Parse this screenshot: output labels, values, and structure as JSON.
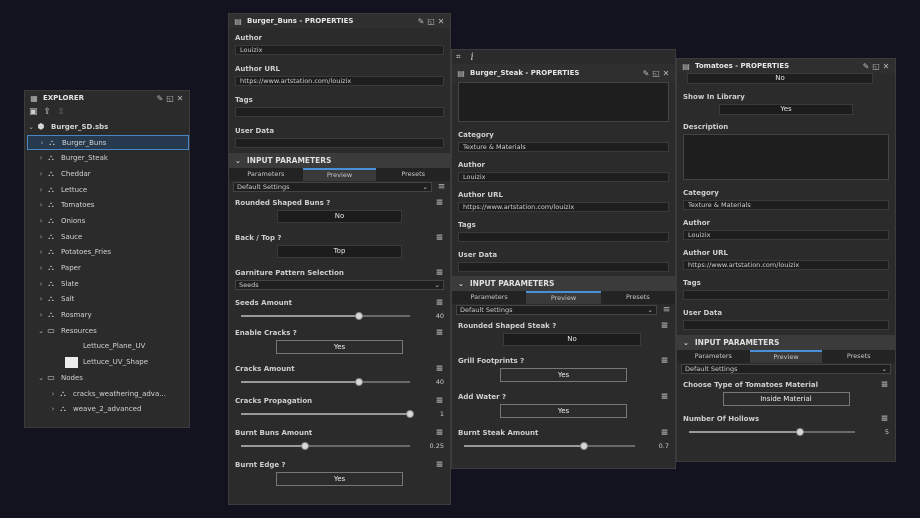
{
  "explorer": {
    "title": "EXPLORER",
    "package": "Burger_SD.sbs",
    "items": [
      {
        "label": "Burger_Buns"
      },
      {
        "label": "Burger_Steak"
      },
      {
        "label": "Cheddar"
      },
      {
        "label": "Lettuce"
      },
      {
        "label": "Tomatoes"
      },
      {
        "label": "Onions"
      },
      {
        "label": "Sauce"
      },
      {
        "label": "Potatoes_Fries"
      },
      {
        "label": "Paper"
      },
      {
        "label": "Slate"
      },
      {
        "label": "Salt"
      },
      {
        "label": "Rosmary"
      }
    ],
    "resources": {
      "label": "Resources",
      "children": [
        {
          "label": "Lettuce_Plane_UV"
        },
        {
          "label": "Lettuce_UV_Shape"
        }
      ]
    },
    "nodes": {
      "label": "Nodes",
      "children": [
        {
          "label": "cracks_weathering_adva..."
        },
        {
          "label": "weave_2_advanced"
        }
      ]
    }
  },
  "common": {
    "author_label": "Author",
    "author_url_label": "Author URL",
    "tags_label": "Tags",
    "user_data_label": "User Data",
    "category_label": "Category",
    "description_label": "Description",
    "show_in_library_label": "Show In Library",
    "input_parameters": "INPUT PARAMETERS",
    "tab_parameters": "Parameters",
    "tab_preview": "Preview",
    "tab_presets": "Presets",
    "default_settings": "Default Settings"
  },
  "buns": {
    "title": "Burger_Buns - PROPERTIES",
    "author": "Louizix",
    "author_url": "https://www.artstation.com/louizix",
    "p1_label": "Rounded Shaped Buns ?",
    "p1_value": "No",
    "p2_label": "Back / Top ?",
    "p2_value": "Top",
    "p3_label": "Garniture Pattern Selection",
    "p3_value": "Seeds",
    "p4_label": "Seeds Amount",
    "p4_value": "40",
    "p4_level": 0.7,
    "p5_label": "Enable Cracks ?",
    "p5_value": "Yes",
    "p6_label": "Cracks Amount",
    "p6_value": "40",
    "p6_level": 0.7,
    "p7_label": "Cracks Propagation",
    "p7_value": "1",
    "p7_level": 1.0,
    "p8_label": "Burnt Buns Amount",
    "p8_value": "0.25",
    "p8_level": 0.38,
    "p9_label": "Burnt Edge ?",
    "p9_value": "Yes"
  },
  "steak": {
    "title": "Burger_Steak - PROPERTIES",
    "category": "Texture & Materials",
    "author": "Louizix",
    "author_url": "https://www.artstation.com/louizix",
    "p1_label": "Rounded Shaped Steak ?",
    "p1_value": "No",
    "p2_label": "Grill Footprints ?",
    "p2_value": "Yes",
    "p3_label": "Add Water ?",
    "p3_value": "Yes",
    "p4_label": "Burnt Steak Amount",
    "p4_value": "0.7",
    "p4_level": 0.7
  },
  "tomatoes": {
    "title": "Tomatoes - PROPERTIES",
    "top_value": "No",
    "show_in_library": "Yes",
    "category": "Texture & Materials",
    "author": "Louizix",
    "author_url": "https://www.artstation.com/louizix",
    "p1_label": "Choose Type of Tomatoes Material",
    "p1_value": "Inside Material",
    "p2_label": "Number Of Hollows",
    "p2_value": "5",
    "p2_level": 0.67
  }
}
